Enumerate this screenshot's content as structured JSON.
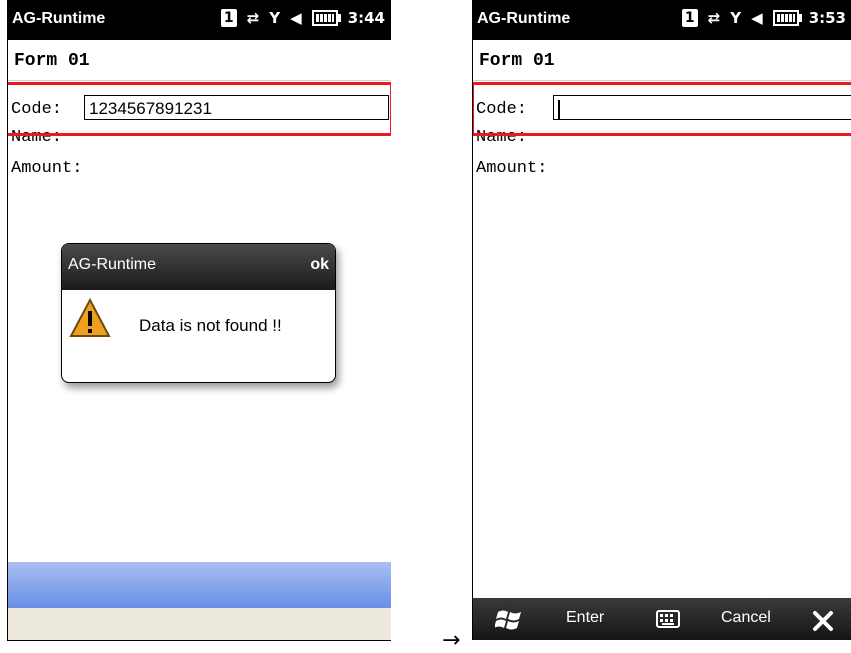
{
  "arrow": "→",
  "left": {
    "status": {
      "app_name": "AG-Runtime",
      "sim": "1",
      "time": "3:44"
    },
    "form_title": "Form 01",
    "fields": {
      "code_label": "Code:",
      "code_value": "1234567891231",
      "name_label": "Name:",
      "amount_label": "Amount:"
    },
    "dialog": {
      "title": "AG-Runtime",
      "ok": "ok",
      "message": "Data is not found !!"
    }
  },
  "right": {
    "status": {
      "app_name": "AG-Runtime",
      "sim": "1",
      "time": "3:53"
    },
    "form_title": "Form 01",
    "fields": {
      "code_label": "Code:",
      "code_value": "",
      "name_label": "Name:",
      "amount_label": "Amount:"
    },
    "softkeys": {
      "enter": "Enter",
      "cancel": "Cancel"
    }
  },
  "colors": {
    "highlight": "#e8191f",
    "warning": "#f0a020"
  },
  "icons": [
    "windows-start-icon",
    "keyboard-icon",
    "close-icon",
    "warning-icon",
    "signal-icon",
    "speaker-icon",
    "battery-icon",
    "data-transfer-icon"
  ]
}
